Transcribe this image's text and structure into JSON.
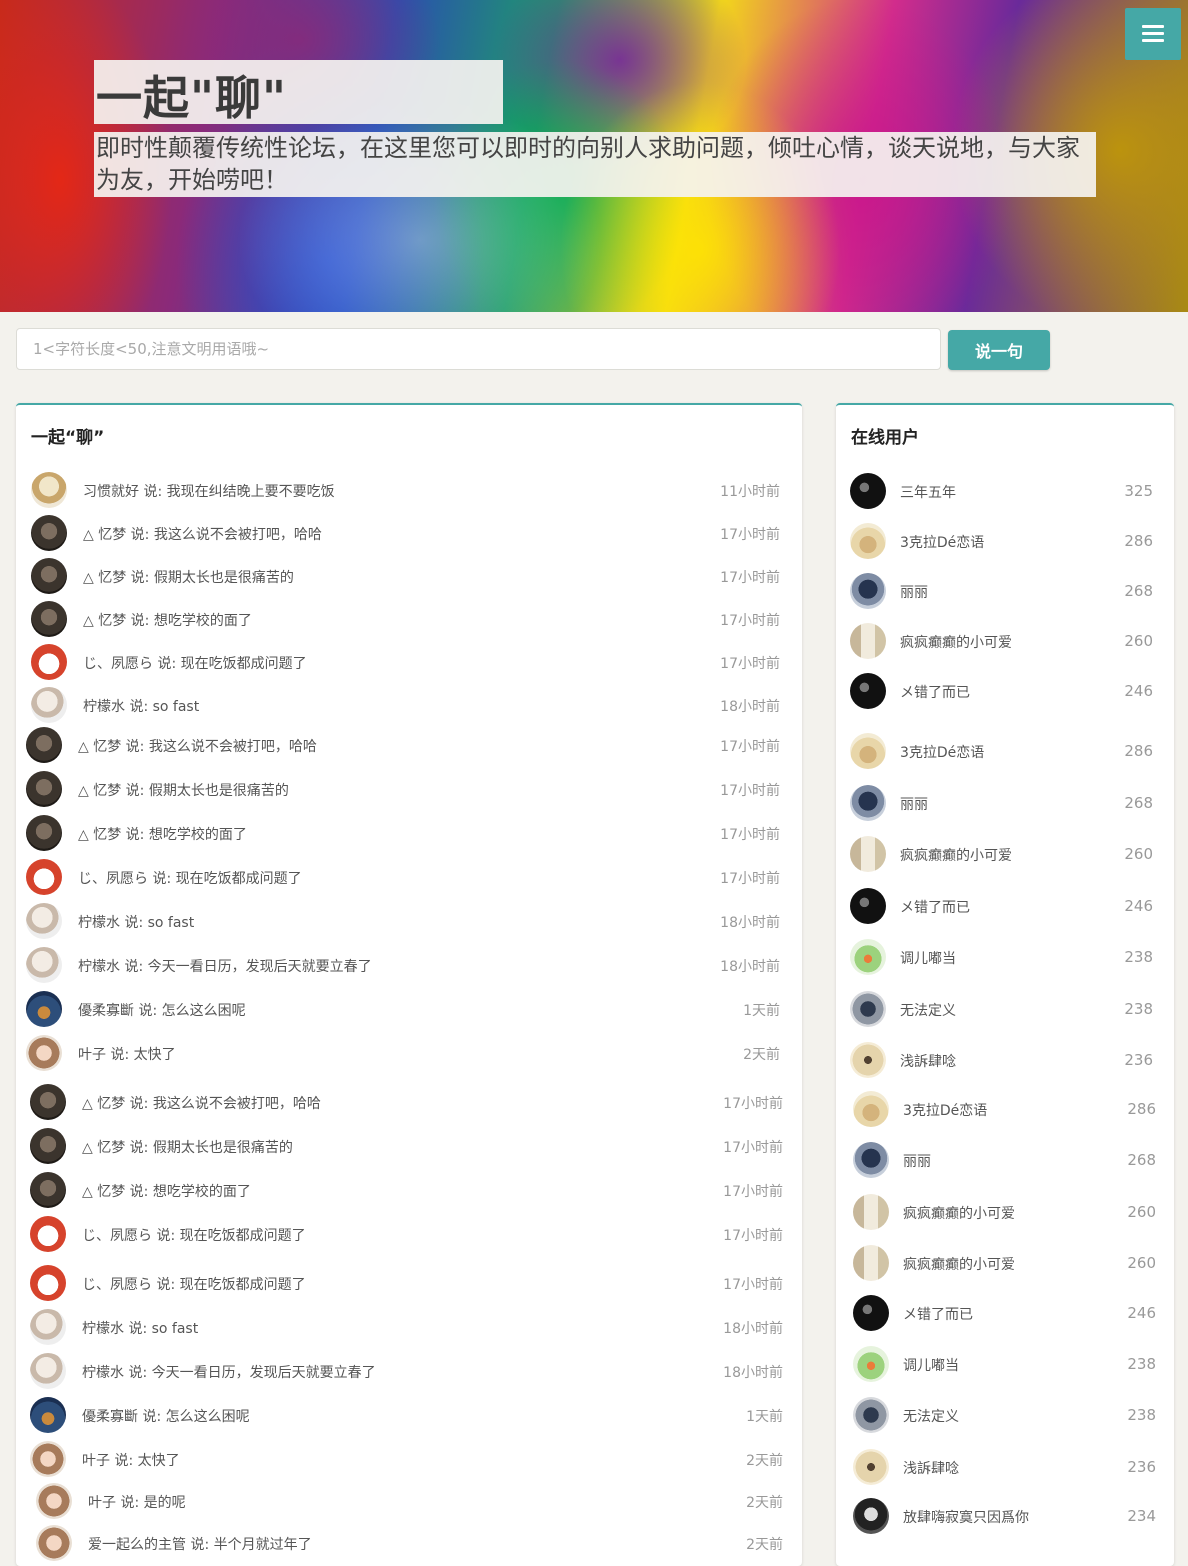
{
  "hero": {
    "title": "一起\"聊\"",
    "subtitle": "即时性颠覆传统性论坛，在这里您可以即时的向别人求助问题，倾吐心情，谈天说地，与大家为友，开始唠吧！",
    "menu_icon": "hamburger-menu-icon"
  },
  "composer": {
    "placeholder": "1<字符长度<50,注意文明用语哦~",
    "send_label": "说一句"
  },
  "chat": {
    "title": "一起“聊”",
    "messages": [
      {
        "avatar": "beige",
        "text": "习惯就好 说: 我现在纠结晚上要不要吃饭",
        "time": "11小时前"
      },
      {
        "avatar": "dark",
        "text": "△  忆梦 说: 我这么说不会被打吧，哈哈",
        "time": "17小时前"
      },
      {
        "avatar": "dark",
        "text": "△  忆梦 说: 假期太长也是很痛苦的",
        "time": "17小时前"
      },
      {
        "avatar": "dark",
        "text": "△  忆梦 说: 想吃学校的面了",
        "time": "17小时前"
      },
      {
        "avatar": "red",
        "text": "じ、夙愿ら 说: 现在吃饭都成问题了",
        "time": "17小时前"
      },
      {
        "avatar": "white",
        "text": "柠檬水 说: so fast",
        "time": "18小时前"
      },
      {
        "avatar": "dark",
        "text": "△  忆梦 说: 我这么说不会被打吧，哈哈",
        "time": "17小时前"
      },
      {
        "avatar": "dark",
        "text": "△  忆梦 说: 假期太长也是很痛苦的",
        "time": "17小时前"
      },
      {
        "avatar": "dark",
        "text": "△  忆梦 说: 想吃学校的面了",
        "time": "17小时前"
      },
      {
        "avatar": "red",
        "text": "じ、夙愿ら 说: 现在吃饭都成问题了",
        "time": "17小时前"
      },
      {
        "avatar": "white",
        "text": "柠檬水 说: so fast",
        "time": "18小时前"
      },
      {
        "avatar": "white",
        "text": "柠檬水 说: 今天一看日历，发现后天就要立春了",
        "time": "18小时前"
      },
      {
        "avatar": "blue",
        "text": "優柔寡斷 说: 怎么这么困呢",
        "time": "1天前"
      },
      {
        "avatar": "girl",
        "text": "叶子 说: 太快了",
        "time": "2天前"
      },
      {
        "avatar": "dark",
        "text": "△  忆梦 说: 我这么说不会被打吧，哈哈",
        "time": "17小时前"
      },
      {
        "avatar": "dark",
        "text": "△  忆梦 说: 假期太长也是很痛苦的",
        "time": "17小时前"
      },
      {
        "avatar": "dark",
        "text": "△  忆梦 说: 想吃学校的面了",
        "time": "17小时前"
      },
      {
        "avatar": "red",
        "text": "じ、夙愿ら 说: 现在吃饭都成问题了",
        "time": "17小时前"
      },
      {
        "avatar": "red",
        "text": "じ、夙愿ら 说: 现在吃饭都成问题了",
        "time": "17小时前"
      },
      {
        "avatar": "white",
        "text": "柠檬水 说: so fast",
        "time": "18小时前"
      },
      {
        "avatar": "white",
        "text": "柠檬水 说: 今天一看日历，发现后天就要立春了",
        "time": "18小时前"
      },
      {
        "avatar": "blue",
        "text": "優柔寡斷 说: 怎么这么困呢",
        "time": "1天前"
      },
      {
        "avatar": "girl",
        "text": "叶子 说: 太快了",
        "time": "2天前"
      },
      {
        "avatar": "girl",
        "text": "叶子 说: 是的呢",
        "time": "2天前"
      },
      {
        "avatar": "girl",
        "text": "爱一起么的主管 说: 半个月就过年了",
        "time": "2天前"
      }
    ]
  },
  "online": {
    "title": "在线用户",
    "users": [
      {
        "avatar": "black",
        "name": "三年五年",
        "score": "325"
      },
      {
        "avatar": "cream",
        "name": "3克拉Dé恋语",
        "score": "286"
      },
      {
        "avatar": "navy",
        "name": "丽丽",
        "score": "268"
      },
      {
        "avatar": "book",
        "name": "疯疯癫癫的小可爱",
        "score": "260"
      },
      {
        "avatar": "black",
        "name": "メ错了而已",
        "score": "246"
      },
      {
        "avatar": "cream",
        "name": "3克拉Dé恋语",
        "score": "286"
      },
      {
        "avatar": "navy",
        "name": "丽丽",
        "score": "268"
      },
      {
        "avatar": "book",
        "name": "疯疯癫癫的小可爱",
        "score": "260"
      },
      {
        "avatar": "black",
        "name": "メ错了而已",
        "score": "246"
      },
      {
        "avatar": "green",
        "name": "调儿嘟当",
        "score": "238"
      },
      {
        "avatar": "gray",
        "name": "无法定义",
        "score": "238"
      },
      {
        "avatar": "sketch",
        "name": "浅訴肆唸",
        "score": "236"
      },
      {
        "avatar": "cream",
        "name": "3克拉Dé恋语",
        "score": "286"
      },
      {
        "avatar": "navy",
        "name": "丽丽",
        "score": "268"
      },
      {
        "avatar": "book",
        "name": "疯疯癫癫的小可爱",
        "score": "260"
      },
      {
        "avatar": "book",
        "name": "疯疯癫癫的小可爱",
        "score": "260"
      },
      {
        "avatar": "black",
        "name": "メ错了而已",
        "score": "246"
      },
      {
        "avatar": "green",
        "name": "调儿嘟当",
        "score": "238"
      },
      {
        "avatar": "gray",
        "name": "无法定义",
        "score": "238"
      },
      {
        "avatar": "sketch",
        "name": "浅訴肆唸",
        "score": "236"
      },
      {
        "avatar": "bw",
        "name": "放肆嗨寂寞只因爲你",
        "score": "234"
      }
    ]
  }
}
